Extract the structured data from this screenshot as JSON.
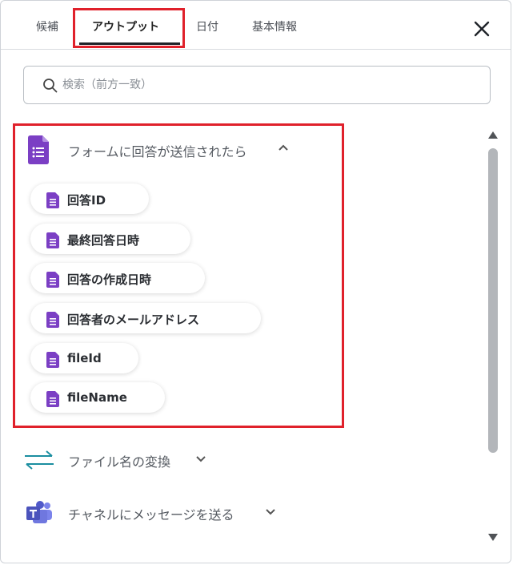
{
  "tabs": [
    {
      "label": "候補"
    },
    {
      "label": "アウトプット"
    },
    {
      "label": "日付"
    },
    {
      "label": "基本情報"
    }
  ],
  "search": {
    "placeholder": "検索（前方一致）",
    "value": ""
  },
  "section_form": {
    "title": "フォームに回答が送信されたら",
    "items": [
      {
        "label": "回答ID"
      },
      {
        "label": "最終回答日時"
      },
      {
        "label": "回答の作成日時"
      },
      {
        "label": "回答者のメールアドレス"
      },
      {
        "label": "fileId"
      },
      {
        "label": "fileName"
      }
    ]
  },
  "section_convert": {
    "title": "ファイル名の変換"
  },
  "section_teams": {
    "title": "チャネルにメッセージを送る"
  },
  "colors": {
    "highlight": "#e0212b",
    "forms_purple": "#7b3fc4",
    "convert_teal": "#1b8ea0",
    "teams_indigo": "#5059c9"
  },
  "icons": {
    "close": "close-icon",
    "search": "search-icon",
    "forms": "google-forms-icon",
    "convert": "arrows-exchange-icon",
    "teams": "microsoft-teams-icon",
    "chevron_up": "chevron-up-icon",
    "chevron_down": "chevron-down-icon"
  }
}
